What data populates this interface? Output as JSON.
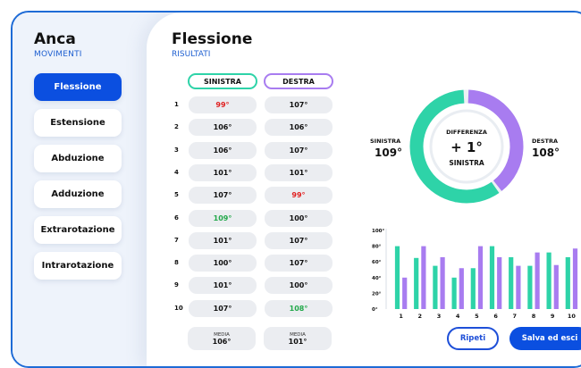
{
  "sidebar": {
    "title": "Anca",
    "subtitle": "MOVIMENTI",
    "items": [
      {
        "label": "Flessione",
        "active": true
      },
      {
        "label": "Estensione",
        "active": false
      },
      {
        "label": "Abduzione",
        "active": false
      },
      {
        "label": "Adduzione",
        "active": false
      },
      {
        "label": "Extrarotazione",
        "active": false
      },
      {
        "label": "Intrarotazione",
        "active": false
      }
    ]
  },
  "main": {
    "title": "Flessione",
    "subtitle": "RISULTATI"
  },
  "table": {
    "left_header": "SINISTRA",
    "right_header": "DESTRA",
    "rows": [
      {
        "n": "1",
        "left": "99°",
        "right": "107°",
        "left_color": "red",
        "right_color": ""
      },
      {
        "n": "2",
        "left": "106°",
        "right": "106°",
        "left_color": "",
        "right_color": ""
      },
      {
        "n": "3",
        "left": "106°",
        "right": "107°",
        "left_color": "",
        "right_color": ""
      },
      {
        "n": "4",
        "left": "101°",
        "right": "101°",
        "left_color": "",
        "right_color": ""
      },
      {
        "n": "5",
        "left": "107°",
        "right": "99°",
        "left_color": "",
        "right_color": "red"
      },
      {
        "n": "6",
        "left": "109°",
        "right": "100°",
        "left_color": "green",
        "right_color": ""
      },
      {
        "n": "7",
        "left": "101°",
        "right": "107°",
        "left_color": "",
        "right_color": ""
      },
      {
        "n": "8",
        "left": "100°",
        "right": "107°",
        "left_color": "",
        "right_color": ""
      },
      {
        "n": "9",
        "left": "101°",
        "right": "100°",
        "left_color": "",
        "right_color": ""
      },
      {
        "n": "10",
        "left": "107°",
        "right": "108°",
        "left_color": "",
        "right_color": "green"
      }
    ],
    "media_label": "MEDIA",
    "media_left": "106°",
    "media_right": "101°"
  },
  "summary": {
    "left_label": "SINISTRA",
    "left_value": "109°",
    "right_label": "DESTRA",
    "right_value": "108°",
    "center_title": "DIFFERENZA",
    "center_value": "+ 1°",
    "center_side": "SINISTRA",
    "left_fraction": 0.6,
    "colors": {
      "left": "#2ed3a8",
      "right": "#a87cf0"
    }
  },
  "chart_data": {
    "type": "bar",
    "categories": [
      "1",
      "2",
      "3",
      "4",
      "5",
      "6",
      "7",
      "8",
      "9",
      "10"
    ],
    "series": [
      {
        "values": [
          80,
          65,
          55,
          40,
          52,
          80,
          66,
          55,
          72,
          66
        ],
        "color": "#2ed3a8"
      },
      {
        "values": [
          40,
          80,
          66,
          52,
          80,
          66,
          55,
          72,
          56,
          77
        ],
        "color": "#a87cf0"
      }
    ],
    "ylim": [
      0,
      100
    ],
    "yticks": [
      "0°",
      "20°",
      "40°",
      "60°",
      "80°",
      "100°"
    ]
  },
  "buttons": {
    "repeat": "Ripeti",
    "save": "Salva ed esci"
  }
}
